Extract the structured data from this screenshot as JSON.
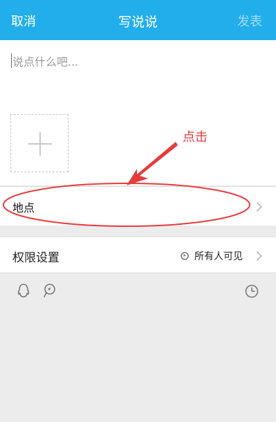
{
  "header": {
    "cancel_label": "取消",
    "title": "写说说",
    "publish_label": "发表"
  },
  "compose": {
    "placeholder": "说点什么吧...",
    "add_photo_icon": "plus-icon"
  },
  "location": {
    "label": "地点",
    "icon": "chevron-right-icon"
  },
  "permission": {
    "label": "权限设置",
    "value": "所有人可见",
    "value_icon": "globe-icon"
  },
  "toolbar": {
    "icons": [
      "qq-penguin-icon",
      "location-pin-icon",
      "clock-icon"
    ]
  },
  "annotation": {
    "text": "点击",
    "color": "#e63b3b"
  },
  "colors": {
    "header_bg": "#22aeea",
    "header_text": "#ffffff",
    "publish_disabled": "#a5dcf6",
    "page_bg": "#ececec"
  }
}
